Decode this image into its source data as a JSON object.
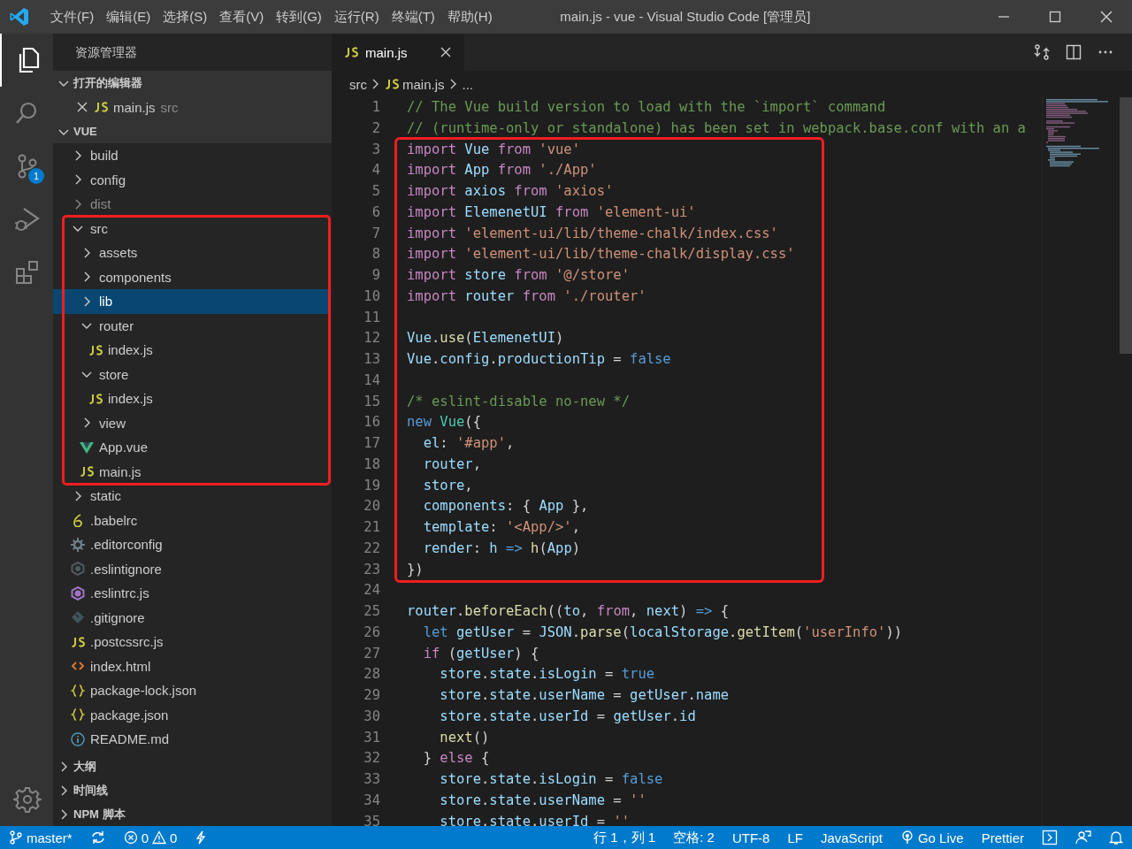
{
  "window": {
    "title": "main.js - vue - Visual Studio Code [管理员]"
  },
  "menu": [
    "文件(F)",
    "编辑(E)",
    "选择(S)",
    "查看(V)",
    "转到(G)",
    "运行(R)",
    "终端(T)",
    "帮助(H)"
  ],
  "activity_bar": [
    {
      "kind": "explorer",
      "selected": true
    },
    {
      "kind": "search",
      "selected": false
    },
    {
      "kind": "scm",
      "selected": false,
      "badge": "1"
    },
    {
      "kind": "debug",
      "selected": false
    },
    {
      "kind": "extensions",
      "selected": false
    }
  ],
  "sidebar": {
    "title": "资源管理器",
    "open_editors": {
      "title": "打开的编辑器",
      "expanded": true,
      "items": [
        {
          "kind": "js",
          "name": "main.js",
          "folder": "src"
        }
      ]
    },
    "folder": {
      "title": "VUE",
      "expanded": true,
      "items": [
        {
          "kind": "folder",
          "name": "build",
          "expanded": false,
          "selected": false,
          "dimmed": false,
          "boxed": false
        },
        {
          "kind": "folder",
          "name": "config",
          "expanded": false,
          "selected": false,
          "dimmed": false,
          "boxed": false
        },
        {
          "kind": "folder",
          "name": "dist",
          "expanded": false,
          "selected": false,
          "dimmed": true,
          "boxed": false
        },
        {
          "kind": "folder",
          "name": "src",
          "expanded": true,
          "selected": false,
          "dimmed": false,
          "boxed": true,
          "children": [
            {
              "kind": "folder",
              "name": "assets",
              "expanded": false,
              "selected": false,
              "dimmed": false,
              "boxed": false
            },
            {
              "kind": "folder",
              "name": "components",
              "expanded": false,
              "selected": false,
              "dimmed": false,
              "boxed": false
            },
            {
              "kind": "folder",
              "name": "lib",
              "expanded": false,
              "selected": true,
              "dimmed": false,
              "boxed": false
            },
            {
              "kind": "folder",
              "name": "router",
              "expanded": true,
              "selected": false,
              "dimmed": false,
              "boxed": false,
              "children": [
                {
                  "kind": "js",
                  "name": "index.js",
                  "selected": false,
                  "dimmed": false,
                  "boxed": false
                }
              ]
            },
            {
              "kind": "folder",
              "name": "store",
              "expanded": true,
              "selected": false,
              "dimmed": false,
              "boxed": false,
              "children": [
                {
                  "kind": "js",
                  "name": "index.js",
                  "selected": false,
                  "dimmed": false,
                  "boxed": false
                }
              ]
            },
            {
              "kind": "folder",
              "name": "view",
              "expanded": false,
              "selected": false,
              "dimmed": false,
              "boxed": false
            },
            {
              "kind": "vue",
              "name": "App.vue",
              "selected": false,
              "dimmed": false,
              "boxed": false
            },
            {
              "kind": "js",
              "name": "main.js",
              "selected": false,
              "dimmed": false,
              "boxed": false
            }
          ]
        },
        {
          "kind": "folder",
          "name": "static",
          "expanded": false,
          "selected": false,
          "dimmed": false,
          "boxed": false
        },
        {
          "kind": "babel",
          "name": ".babelrc",
          "selected": false,
          "dimmed": false,
          "boxed": false
        },
        {
          "kind": "gear",
          "name": ".editorconfig",
          "selected": false,
          "dimmed": false,
          "boxed": false
        },
        {
          "kind": "eslintignore",
          "name": ".eslintignore",
          "selected": false,
          "dimmed": false,
          "boxed": false
        },
        {
          "kind": "eslint",
          "name": ".eslintrc.js",
          "selected": false,
          "dimmed": false,
          "boxed": false
        },
        {
          "kind": "git",
          "name": ".gitignore",
          "selected": false,
          "dimmed": false,
          "boxed": false
        },
        {
          "kind": "js",
          "name": ".postcssrc.js",
          "selected": false,
          "dimmed": false,
          "boxed": false
        },
        {
          "kind": "html",
          "name": "index.html",
          "selected": false,
          "dimmed": false,
          "boxed": false
        },
        {
          "kind": "json",
          "name": "package-lock.json",
          "selected": false,
          "dimmed": false,
          "boxed": false
        },
        {
          "kind": "json",
          "name": "package.json",
          "selected": false,
          "dimmed": false,
          "boxed": false
        },
        {
          "kind": "info",
          "name": "README.md",
          "selected": false,
          "dimmed": false,
          "boxed": false
        }
      ]
    },
    "bottom_sections": [
      {
        "title": "大纲",
        "expanded": false
      },
      {
        "title": "时间线",
        "expanded": false
      },
      {
        "title": "NPM 脚本",
        "expanded": false
      }
    ]
  },
  "tabs": [
    {
      "kind": "js",
      "label": "main.js",
      "selected": true
    }
  ],
  "breadcrumb": [
    "src",
    "main.js",
    "..."
  ],
  "code": {
    "blocks": [
      {
        "boxed": false,
        "lines": [
          {
            "number": "1",
            "text": "// The Vue build version to load with the `import` command"
          },
          {
            "number": "2",
            "text": "// (runtime-only or standalone) has been set in webpack.base.conf with an a"
          }
        ]
      },
      {
        "boxed": true,
        "lines": [
          {
            "number": "3",
            "text": "import Vue from 'vue'"
          },
          {
            "number": "4",
            "text": "import App from './App'"
          },
          {
            "number": "5",
            "text": "import axios from 'axios'"
          },
          {
            "number": "6",
            "text": "import ElemenetUI from 'element-ui'"
          },
          {
            "number": "7",
            "text": "import 'element-ui/lib/theme-chalk/index.css'"
          },
          {
            "number": "8",
            "text": "import 'element-ui/lib/theme-chalk/display.css'"
          },
          {
            "number": "9",
            "text": "import store from '@/store'"
          },
          {
            "number": "10",
            "text": "import router from './router'"
          },
          {
            "number": "11"
          },
          {
            "number": "12",
            "text": "Vue.use(ElemenetUI)"
          },
          {
            "number": "13",
            "text": "Vue.config.productionTip = false"
          },
          {
            "number": "14"
          },
          {
            "number": "15",
            "text": "/* eslint-disable no-new */"
          },
          {
            "number": "16",
            "text": "new Vue({"
          },
          {
            "number": "17",
            "text": "  el: '#app',"
          },
          {
            "number": "18",
            "text": "  router,"
          },
          {
            "number": "19",
            "text": "  store,"
          },
          {
            "number": "20",
            "text": "  components: { App },"
          },
          {
            "number": "21",
            "text": "  template: '<App/>',"
          },
          {
            "number": "22",
            "text": "  render: h => h(App)"
          },
          {
            "number": "23",
            "text": "})"
          }
        ]
      },
      {
        "boxed": false,
        "lines": [
          {
            "number": "24"
          },
          {
            "number": "25",
            "text": "router.beforeEach((to, from, next) => {"
          },
          {
            "number": "26",
            "text": "  let getUser = JSON.parse(localStorage.getItem('userInfo'))"
          },
          {
            "number": "27",
            "text": "  if (getUser) {"
          },
          {
            "number": "28",
            "text": "    store.state.isLogin = true"
          },
          {
            "number": "29",
            "text": "    store.state.userName = getUser.name"
          },
          {
            "number": "30",
            "text": "    store.state.userId = getUser.id"
          },
          {
            "number": "31",
            "text": "    next()"
          },
          {
            "number": "32",
            "text": "  } else {"
          },
          {
            "number": "33",
            "text": "    store.state.isLogin = false"
          },
          {
            "number": "34",
            "text": "    store.state.userName = ''"
          },
          {
            "number": "35",
            "text": "    store.state.userId = ''"
          }
        ]
      }
    ]
  },
  "status_bar": {
    "branch": "master*",
    "errors": "0",
    "warnings": "0",
    "cursor": "行 1，列 1",
    "indent": "空格: 2",
    "encoding": "UTF-8",
    "eol": "LF",
    "language": "JavaScript",
    "live": "Go Live",
    "formatter": "Prettier"
  }
}
